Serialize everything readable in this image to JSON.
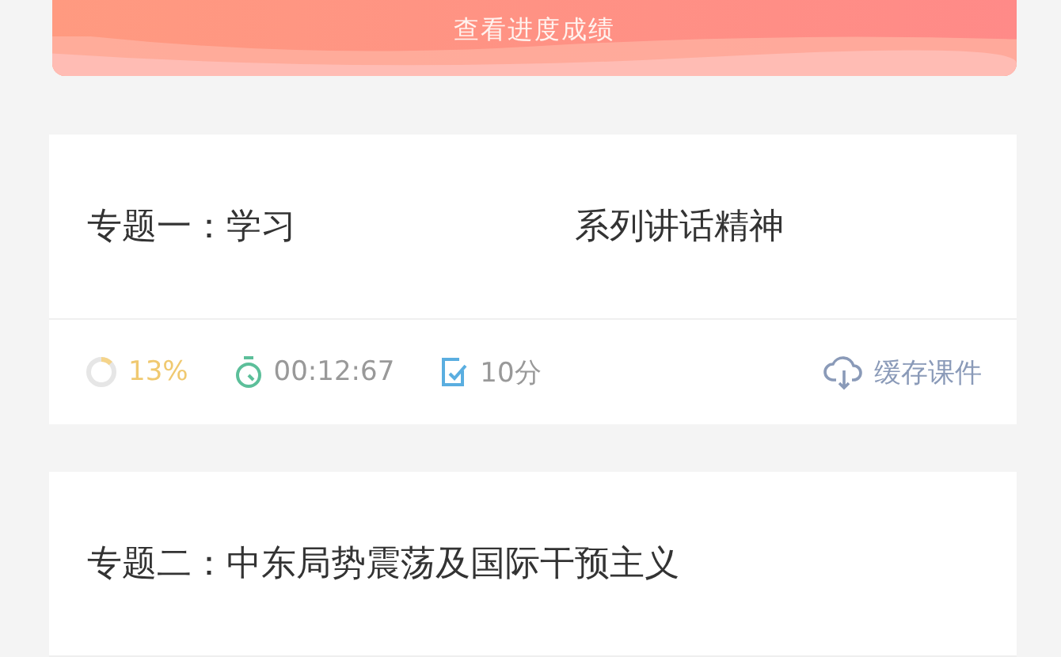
{
  "banner": {
    "label": "查看进度成绩"
  },
  "courses": [
    {
      "title_parts": [
        "专题一：学习",
        "系列讲话精神"
      ],
      "meta": {
        "progress": {
          "level": 0.13,
          "text": "13%"
        },
        "duration": "00:12:67",
        "score": "10分",
        "cache": "缓存课件"
      }
    },
    {
      "title_parts": [
        "专题二：中东局势震荡及国际干预主义"
      ]
    }
  ]
}
